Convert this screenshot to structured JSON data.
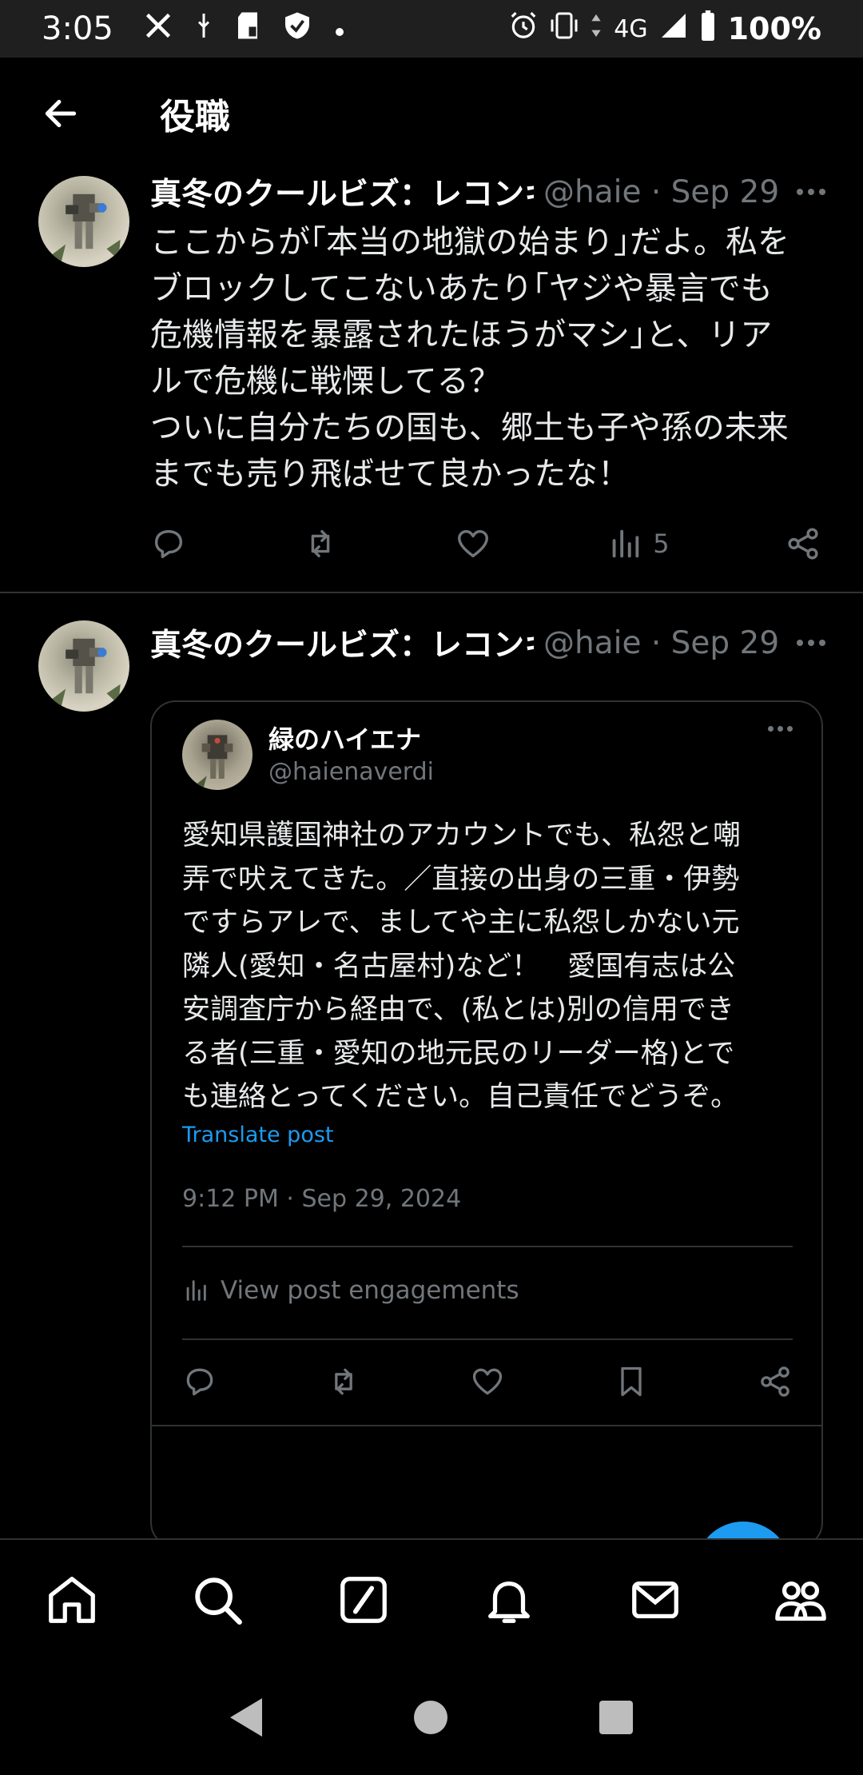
{
  "status_bar": {
    "time": "3:05",
    "network": "4G",
    "battery": "100%",
    "icons": [
      "x-logo-icon",
      "usb-icon",
      "sd-card-icon",
      "shield-icon",
      "dot-icon",
      "alarm-icon",
      "vibrate-icon",
      "data-arrows-icon",
      "signal-icon",
      "battery-icon"
    ]
  },
  "header": {
    "title": "役職"
  },
  "tweets": [
    {
      "display_name": "真冬のクールビズ：レコンキ",
      "handle_date": "@haie · Sep 29",
      "text": "ここからが｢本当の地獄の始まり｣だよ。私を\nブロックしてこないあたり｢ヤジや暴言でも\n危機情報を暴露されたほうがマシ｣と、リア\nルで危機に戦慄してる？\nついに自分たちの国も、郷土も子や孫の未来\nまでも売り飛ばせて良かったな！",
      "views": "5"
    },
    {
      "display_name": "真冬のクールビズ：レコンキ",
      "handle_date": "@haie · Sep 29"
    }
  ],
  "quoted": {
    "display_name": "緑のハイエナ",
    "handle": "@haienaverdi",
    "text": "愛知県護国神社のアカウントでも、私怨と嘲\n弄で吠えてきた。／直接の出身の三重・伊勢\nですらアレで、ましてや主に私怨しかない元\n隣人(愛知・名古屋村)など！　愛国有志は公\n安調査庁から経由で、(私とは)別の信用でき\nる者(三重・愛知の地元民のリーダー格)とで\nも連絡とってください。自己責任でどうぞ。",
    "translate": "Translate post",
    "timestamp": "9:12 PM · Sep 29, 2024",
    "engagements": "View post engagements"
  },
  "colors": {
    "background": "#000000",
    "accent": "#1d9bf0",
    "secondary_text": "#71767b",
    "border": "#2f3336"
  },
  "bottom_nav": [
    "home-icon",
    "search-icon",
    "grok-icon",
    "notifications-icon",
    "messages-icon",
    "communities-icon"
  ]
}
